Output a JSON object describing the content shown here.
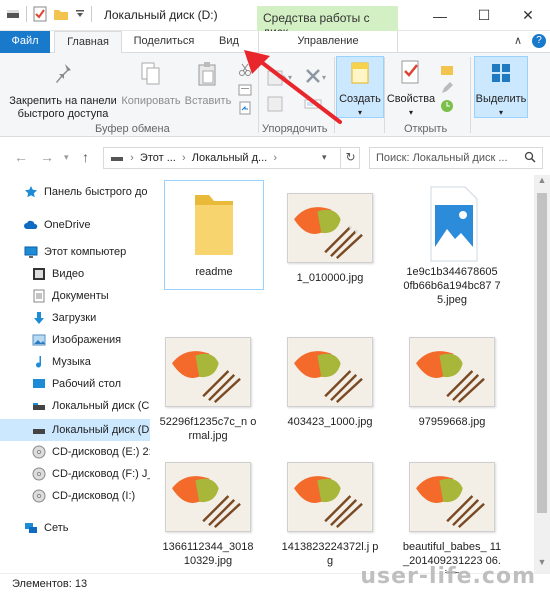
{
  "window": {
    "title": "Локальный диск (D:)",
    "context_tab_header": "Средства работы с диск...",
    "controls": {
      "minimize": "—",
      "maximize": "☐",
      "close": "✕"
    }
  },
  "tabs": {
    "file": "Файл",
    "home": "Главная",
    "share": "Поделиться",
    "view": "Вид",
    "manage": "Управление",
    "collapse": "∧",
    "help": "?"
  },
  "ribbon": {
    "pin": "Закрепить на панели быстрого доступа",
    "pin_line1": "Закрепить на панели",
    "pin_line2": "быстрого доступа",
    "copy": "Копировать",
    "paste": "Вставить",
    "group_clipboard": "Буфер обмена",
    "group_organize": "Упорядочить",
    "create": "Создать",
    "properties": "Свойства",
    "group_open": "Открыть",
    "select": "Выделить"
  },
  "address": {
    "crumb1": "Этот ...",
    "crumb2": "Локальный д...",
    "search_placeholder": "Поиск: Локальный диск ..."
  },
  "nav": {
    "items": [
      {
        "label": "Панель быстрого до",
        "icon": "star-icon"
      },
      {
        "label": "OneDrive",
        "icon": "cloud-icon"
      },
      {
        "label": "Этот компьютер",
        "icon": "computer-icon"
      },
      {
        "label": "Видео",
        "icon": "video-icon"
      },
      {
        "label": "Документы",
        "icon": "documents-icon"
      },
      {
        "label": "Загрузки",
        "icon": "download-icon"
      },
      {
        "label": "Изображения",
        "icon": "images-icon"
      },
      {
        "label": "Музыка",
        "icon": "music-icon"
      },
      {
        "label": "Рабочий стол",
        "icon": "desktop-icon"
      },
      {
        "label": "Локальный диск (C",
        "icon": "drive-icon"
      },
      {
        "label": "Локальный диск (D",
        "icon": "drive-icon"
      },
      {
        "label": "CD-дисковод (E:) 2:",
        "icon": "cd-drive-icon"
      },
      {
        "label": "CD-дисковод (F:) J_",
        "icon": "cd-drive-icon"
      },
      {
        "label": "CD-дисковод (I:)",
        "icon": "cd-drive-icon"
      },
      {
        "label": "Сеть",
        "icon": "network-icon"
      }
    ]
  },
  "files": [
    {
      "name": "readme",
      "type": "folder"
    },
    {
      "name": "1_010000.jpg",
      "type": "image"
    },
    {
      "name": "1e9c1b344678605 0fb66b6a194bc87 75.jpeg",
      "type": "image-placeholder"
    },
    {
      "name": "52296f1235c7c_n ormal.jpg",
      "type": "image"
    },
    {
      "name": "403423_1000.jpg",
      "type": "image"
    },
    {
      "name": "97959668.jpg",
      "type": "image"
    },
    {
      "name": "1366112344_3018 10329.jpg",
      "type": "image"
    },
    {
      "name": "1413823224372l.j pg",
      "type": "image"
    },
    {
      "name": "beautiful_babes_ 11_201409231223 06.jpg",
      "type": "image"
    }
  ],
  "status": {
    "items_count": "Элементов: 13"
  },
  "watermark": "user-life.com",
  "colors": {
    "accent": "#1979ca",
    "context_tab": "#d3f0c4",
    "selection": "#cce8ff",
    "annotation_arrow": "#e8262b"
  }
}
